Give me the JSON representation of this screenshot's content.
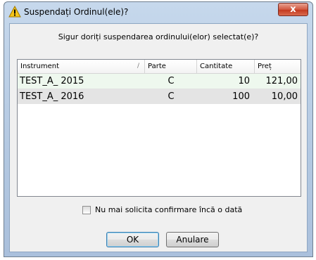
{
  "window": {
    "title": "Suspendați Ordinul(ele)?",
    "close_label": "x"
  },
  "dialog": {
    "question": "Sigur doriți suspendarea ordinului(elor) selectat(e)?"
  },
  "table": {
    "columns": [
      "Instrument",
      "Parte",
      "Cantitate",
      "Preț"
    ],
    "sort_indicator": "/",
    "rows": [
      {
        "instrument": "TEST_A_ 2015",
        "parte": "C",
        "cantitate": "10",
        "pret": "121,00"
      },
      {
        "instrument": "TEST_A_ 2016",
        "parte": "C",
        "cantitate": "100",
        "pret": "10,00"
      }
    ]
  },
  "checkbox": {
    "label": "Nu mai solicita confirmare încă o dată",
    "checked": false
  },
  "buttons": {
    "ok": "OK",
    "cancel": "Anulare"
  },
  "icons": {
    "title_icon": "warning-icon"
  },
  "colors": {
    "warning": "#f5c518",
    "close_button": "#c4391f",
    "first_row_bg": "#eef8ee",
    "selected_row_bg": "#e4e4e4"
  }
}
